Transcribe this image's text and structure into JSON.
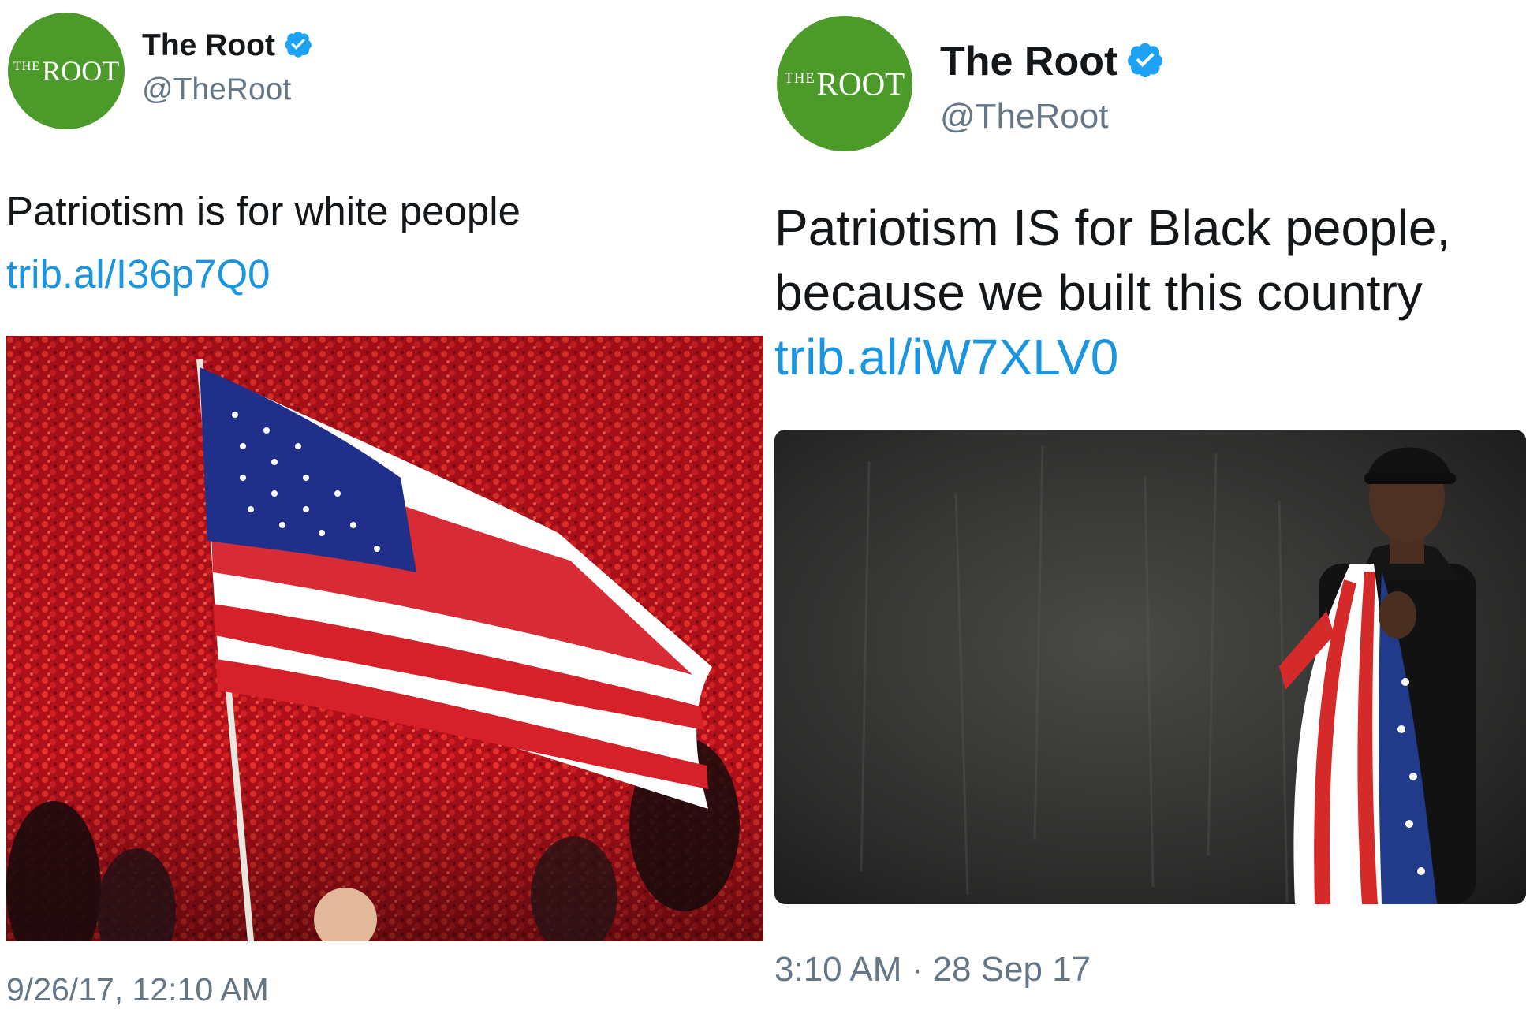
{
  "left_tweet": {
    "avatar": {
      "small": "THE",
      "main": "ROOT"
    },
    "display_name": "The Root",
    "handle": "@TheRoot",
    "text": "Patriotism is for white people ",
    "link": "trib.al/I36p7Q0",
    "image_description_icon": "flag-in-stadium-photo",
    "timestamp": "9/26/17, 12:10 AM"
  },
  "right_tweet": {
    "avatar": {
      "small": "THE",
      "main": "ROOT"
    },
    "display_name": "The Root",
    "handle": "@TheRoot",
    "text": "Patriotism IS for Black people, because we built this country ",
    "link": "trib.al/iW7XLV0",
    "image_description_icon": "man-wearing-flag-photo",
    "timestamp": "3:10 AM · 28 Sep 17"
  },
  "colors": {
    "brand_green": "#4c9a2a",
    "verified_blue": "#1da1f2",
    "link_blue": "#1b95e0",
    "text_gray": "#657786"
  }
}
